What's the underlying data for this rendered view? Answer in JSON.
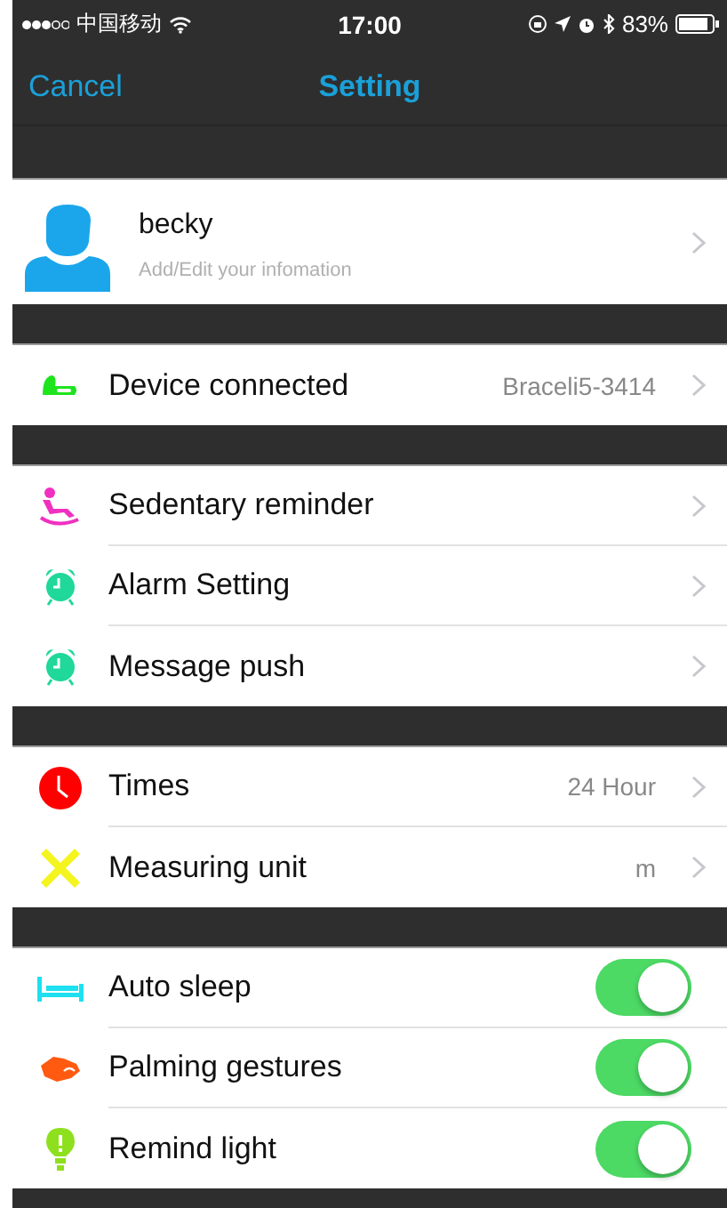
{
  "status_bar": {
    "carrier": "中国移动",
    "time": "17:00",
    "battery": "83%"
  },
  "nav": {
    "cancel": "Cancel",
    "title": "Setting"
  },
  "profile": {
    "name": "becky",
    "subtitle": "Add/Edit your infomation"
  },
  "sections": [
    {
      "rows": [
        {
          "kind": "link",
          "label": "Device connected",
          "value": "Braceli5-3414"
        }
      ]
    },
    {
      "rows": [
        {
          "kind": "link",
          "label": "Sedentary reminder"
        },
        {
          "kind": "link",
          "label": "Alarm Setting"
        },
        {
          "kind": "link",
          "label": "Message push"
        }
      ]
    },
    {
      "rows": [
        {
          "kind": "link",
          "label": "Times",
          "value": "24 Hour"
        },
        {
          "kind": "link",
          "label": "Measuring unit",
          "value": "m"
        }
      ]
    },
    {
      "rows": [
        {
          "kind": "toggle",
          "label": "Auto sleep",
          "on": true
        },
        {
          "kind": "toggle",
          "label": "Palming gestures",
          "on": true
        },
        {
          "kind": "toggle",
          "label": "Remind light",
          "on": true
        }
      ]
    }
  ]
}
